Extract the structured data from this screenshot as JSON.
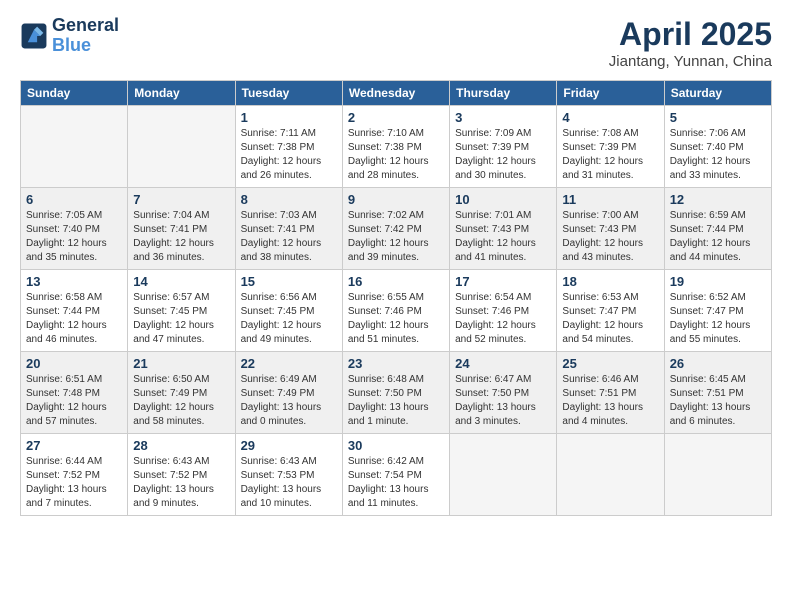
{
  "header": {
    "logo_line1": "General",
    "logo_line2": "Blue",
    "month": "April 2025",
    "location": "Jiantang, Yunnan, China"
  },
  "weekdays": [
    "Sunday",
    "Monday",
    "Tuesday",
    "Wednesday",
    "Thursday",
    "Friday",
    "Saturday"
  ],
  "weeks": [
    [
      {
        "day": "",
        "info": ""
      },
      {
        "day": "",
        "info": ""
      },
      {
        "day": "1",
        "info": "Sunrise: 7:11 AM\nSunset: 7:38 PM\nDaylight: 12 hours\nand 26 minutes."
      },
      {
        "day": "2",
        "info": "Sunrise: 7:10 AM\nSunset: 7:38 PM\nDaylight: 12 hours\nand 28 minutes."
      },
      {
        "day": "3",
        "info": "Sunrise: 7:09 AM\nSunset: 7:39 PM\nDaylight: 12 hours\nand 30 minutes."
      },
      {
        "day": "4",
        "info": "Sunrise: 7:08 AM\nSunset: 7:39 PM\nDaylight: 12 hours\nand 31 minutes."
      },
      {
        "day": "5",
        "info": "Sunrise: 7:06 AM\nSunset: 7:40 PM\nDaylight: 12 hours\nand 33 minutes."
      }
    ],
    [
      {
        "day": "6",
        "info": "Sunrise: 7:05 AM\nSunset: 7:40 PM\nDaylight: 12 hours\nand 35 minutes."
      },
      {
        "day": "7",
        "info": "Sunrise: 7:04 AM\nSunset: 7:41 PM\nDaylight: 12 hours\nand 36 minutes."
      },
      {
        "day": "8",
        "info": "Sunrise: 7:03 AM\nSunset: 7:41 PM\nDaylight: 12 hours\nand 38 minutes."
      },
      {
        "day": "9",
        "info": "Sunrise: 7:02 AM\nSunset: 7:42 PM\nDaylight: 12 hours\nand 39 minutes."
      },
      {
        "day": "10",
        "info": "Sunrise: 7:01 AM\nSunset: 7:43 PM\nDaylight: 12 hours\nand 41 minutes."
      },
      {
        "day": "11",
        "info": "Sunrise: 7:00 AM\nSunset: 7:43 PM\nDaylight: 12 hours\nand 43 minutes."
      },
      {
        "day": "12",
        "info": "Sunrise: 6:59 AM\nSunset: 7:44 PM\nDaylight: 12 hours\nand 44 minutes."
      }
    ],
    [
      {
        "day": "13",
        "info": "Sunrise: 6:58 AM\nSunset: 7:44 PM\nDaylight: 12 hours\nand 46 minutes."
      },
      {
        "day": "14",
        "info": "Sunrise: 6:57 AM\nSunset: 7:45 PM\nDaylight: 12 hours\nand 47 minutes."
      },
      {
        "day": "15",
        "info": "Sunrise: 6:56 AM\nSunset: 7:45 PM\nDaylight: 12 hours\nand 49 minutes."
      },
      {
        "day": "16",
        "info": "Sunrise: 6:55 AM\nSunset: 7:46 PM\nDaylight: 12 hours\nand 51 minutes."
      },
      {
        "day": "17",
        "info": "Sunrise: 6:54 AM\nSunset: 7:46 PM\nDaylight: 12 hours\nand 52 minutes."
      },
      {
        "day": "18",
        "info": "Sunrise: 6:53 AM\nSunset: 7:47 PM\nDaylight: 12 hours\nand 54 minutes."
      },
      {
        "day": "19",
        "info": "Sunrise: 6:52 AM\nSunset: 7:47 PM\nDaylight: 12 hours\nand 55 minutes."
      }
    ],
    [
      {
        "day": "20",
        "info": "Sunrise: 6:51 AM\nSunset: 7:48 PM\nDaylight: 12 hours\nand 57 minutes."
      },
      {
        "day": "21",
        "info": "Sunrise: 6:50 AM\nSunset: 7:49 PM\nDaylight: 12 hours\nand 58 minutes."
      },
      {
        "day": "22",
        "info": "Sunrise: 6:49 AM\nSunset: 7:49 PM\nDaylight: 13 hours\nand 0 minutes."
      },
      {
        "day": "23",
        "info": "Sunrise: 6:48 AM\nSunset: 7:50 PM\nDaylight: 13 hours\nand 1 minute."
      },
      {
        "day": "24",
        "info": "Sunrise: 6:47 AM\nSunset: 7:50 PM\nDaylight: 13 hours\nand 3 minutes."
      },
      {
        "day": "25",
        "info": "Sunrise: 6:46 AM\nSunset: 7:51 PM\nDaylight: 13 hours\nand 4 minutes."
      },
      {
        "day": "26",
        "info": "Sunrise: 6:45 AM\nSunset: 7:51 PM\nDaylight: 13 hours\nand 6 minutes."
      }
    ],
    [
      {
        "day": "27",
        "info": "Sunrise: 6:44 AM\nSunset: 7:52 PM\nDaylight: 13 hours\nand 7 minutes."
      },
      {
        "day": "28",
        "info": "Sunrise: 6:43 AM\nSunset: 7:52 PM\nDaylight: 13 hours\nand 9 minutes."
      },
      {
        "day": "29",
        "info": "Sunrise: 6:43 AM\nSunset: 7:53 PM\nDaylight: 13 hours\nand 10 minutes."
      },
      {
        "day": "30",
        "info": "Sunrise: 6:42 AM\nSunset: 7:54 PM\nDaylight: 13 hours\nand 11 minutes."
      },
      {
        "day": "",
        "info": ""
      },
      {
        "day": "",
        "info": ""
      },
      {
        "day": "",
        "info": ""
      }
    ]
  ]
}
